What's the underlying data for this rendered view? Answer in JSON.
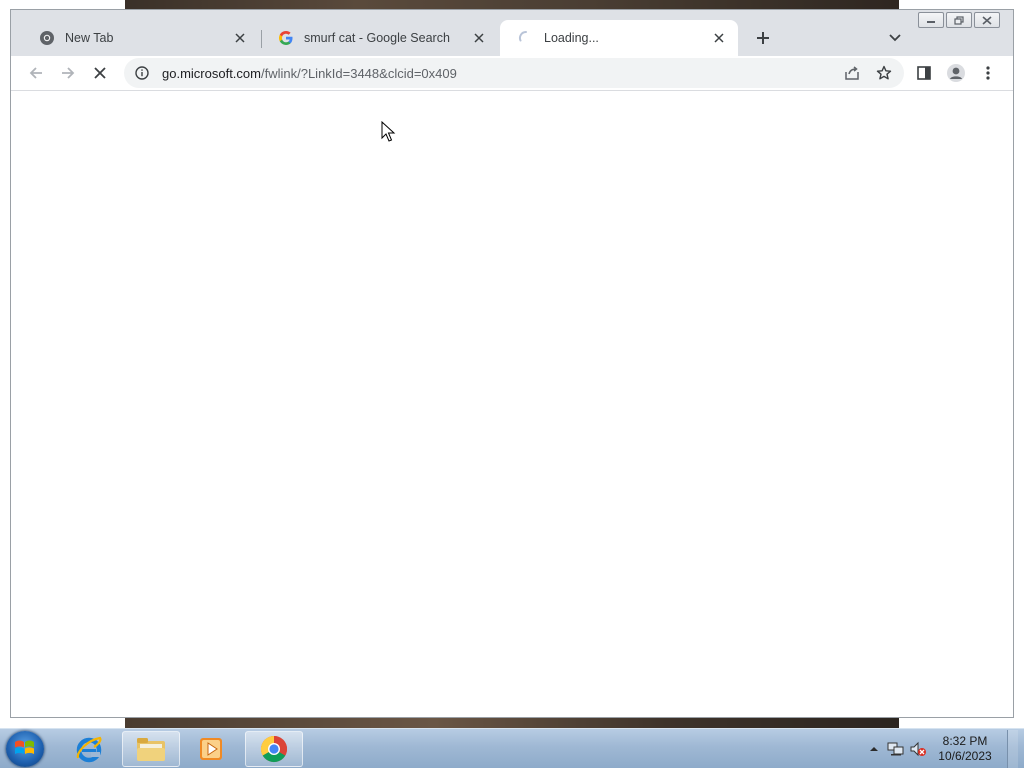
{
  "browser": {
    "tabs": [
      {
        "title": "New Tab",
        "favicon": "chrome-icon",
        "active": false
      },
      {
        "title": "smurf cat - Google Search",
        "favicon": "google-icon",
        "active": false
      },
      {
        "title": "Loading...",
        "favicon": "loading-spinner-icon",
        "active": true
      }
    ],
    "address": {
      "host": "go.microsoft.com",
      "path": "/fwlink/?LinkId=3448&clcid=0x409"
    }
  },
  "taskbar": {
    "apps": [
      {
        "name": "Internet Explorer",
        "icon": "internet-explorer-icon"
      },
      {
        "name": "Windows Explorer",
        "icon": "folder-icon"
      },
      {
        "name": "Windows Media Player",
        "icon": "media-player-icon"
      },
      {
        "name": "Google Chrome",
        "icon": "chrome-icon"
      }
    ],
    "clock": {
      "time": "8:32 PM",
      "date": "10/6/2023"
    }
  },
  "colors": {
    "tab_strip": "#dee1e6",
    "active_tab": "#ffffff",
    "omnibox": "#f1f3f4",
    "taskbar": "#9fb8d4"
  }
}
